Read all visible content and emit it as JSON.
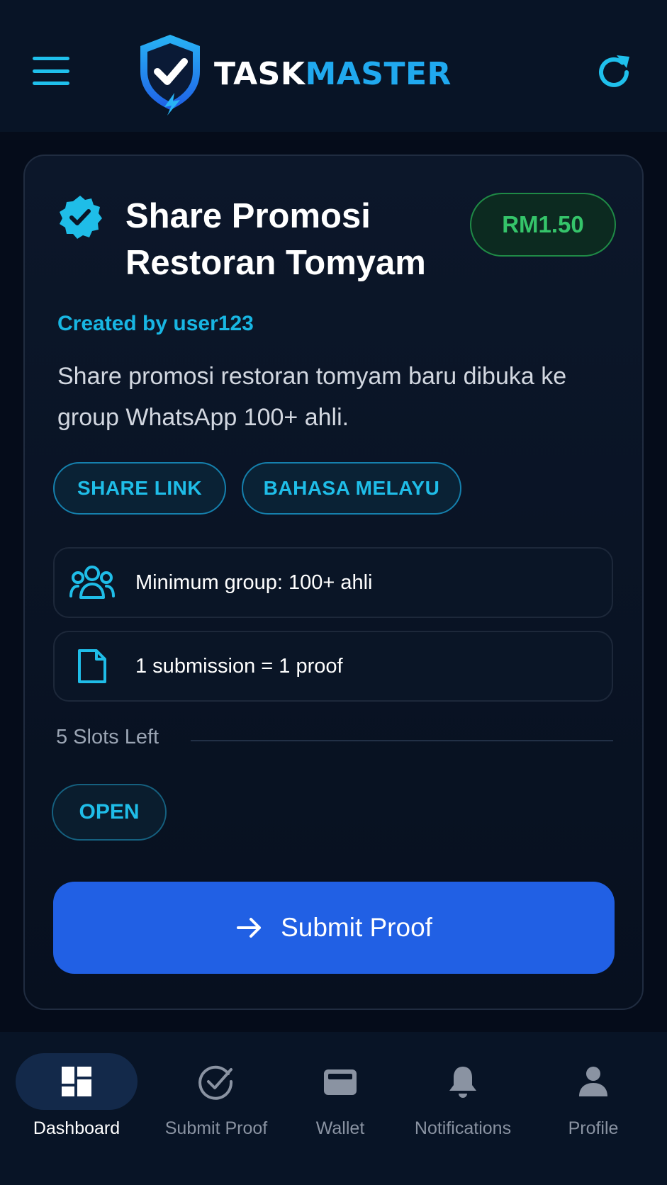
{
  "header": {
    "logo_part1": "TASK",
    "logo_part2": "MASTER"
  },
  "task": {
    "title": "Share Promosi\nRestoran Tomyam",
    "price": "RM1.50",
    "creator": "Created by user123",
    "description": "Share promosi restoran tomyam baru dibuka ke group WhatsApp 100+ ahli.",
    "tags": [
      "SHARE LINK",
      "BAHASA MELAYU"
    ],
    "requirements": [
      {
        "icon": "users-icon",
        "text": "Minimum group: 100+ ahli"
      },
      {
        "icon": "document-icon",
        "text": "1 submission = 1 proof"
      }
    ],
    "slots_left": "5 Slots Left",
    "status": "OPEN",
    "submit_label": "Submit Proof"
  },
  "nav": {
    "items": [
      {
        "label": "Dashboard",
        "icon": "dashboard-icon",
        "active": true
      },
      {
        "label": "Submit Proof",
        "icon": "check-circle-icon",
        "active": false
      },
      {
        "label": "Wallet",
        "icon": "wallet-icon",
        "active": false
      },
      {
        "label": "Notifications",
        "icon": "bell-icon",
        "active": false
      },
      {
        "label": "Profile",
        "icon": "user-icon",
        "active": false
      }
    ]
  },
  "colors": {
    "accent_cyan": "#1fbde8",
    "brand_blue": "#2160e4",
    "price_green": "#35c46a",
    "background": "#060f1e"
  }
}
